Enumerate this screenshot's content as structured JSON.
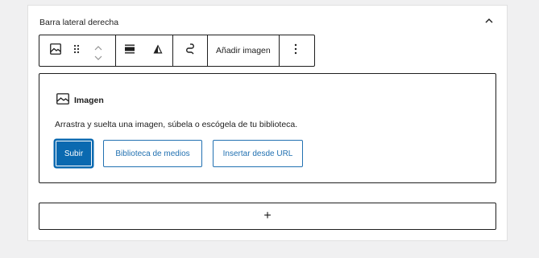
{
  "panel": {
    "title": "Barra lateral derecha",
    "collapse_icon": "chevron-up-icon"
  },
  "toolbar": {
    "block_icon": "image-icon",
    "drag_icon": "drag-handle-icon",
    "move_up_icon": "chevron-up-icon",
    "move_down_icon": "chevron-down-icon",
    "align_icon": "align-center-icon",
    "duotone_icon": "duotone-icon",
    "link_icon": "link-icon",
    "add_image_label": "Añadir imagen",
    "more_icon": "more-vertical-icon"
  },
  "placeholder": {
    "label": "Imagen",
    "instructions": "Arrastra y suelta una imagen, súbela o escógela de tu biblioteca.",
    "upload_label": "Subir",
    "media_library_label": "Biblioteca de medios",
    "insert_url_label": "Insertar desde URL"
  },
  "appender": {
    "label": "+"
  },
  "colors": {
    "primary": "#0a69b0",
    "secondary_text": "#2271b1",
    "border": "#1e1e1e",
    "background": "#f0f0f1"
  }
}
